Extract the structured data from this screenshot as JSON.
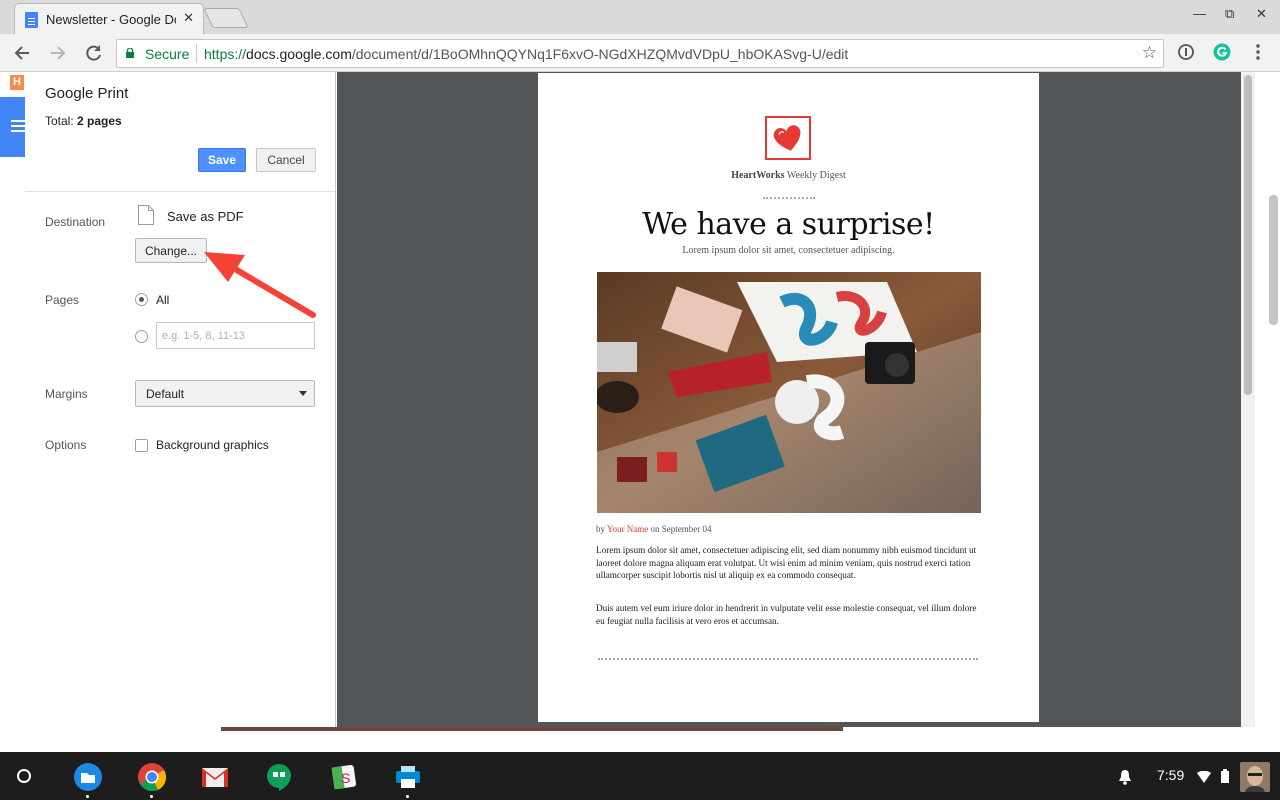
{
  "browser": {
    "tab_title": "Newsletter - Google Docs",
    "tab_close": "✕",
    "window_controls": {
      "minimize": "—",
      "maximize": "⧉",
      "close": "✕"
    },
    "address": {
      "secure_label": "Secure",
      "scheme": "https://",
      "host": "docs.google.com",
      "path": "/document/d/1BoOMhnQQYNq1F6xvO-NGdXHZQMvdVDpU_hbOKASvg-U/edit"
    },
    "icons": [
      "back-icon",
      "forward-icon",
      "reload-icon",
      "lock-icon",
      "star-icon",
      "info-extension-icon",
      "grammarly-icon",
      "menu-icon"
    ]
  },
  "docs": {
    "logo_letter": "H"
  },
  "print": {
    "title": "Google Print",
    "total_label": "Total:",
    "total_value": "2 pages",
    "save_label": "Save",
    "cancel_label": "Cancel",
    "destination_label": "Destination",
    "destination_value": "Save as PDF",
    "change_label": "Change...",
    "pages_label": "Pages",
    "pages_all": "All",
    "pages_placeholder": "e.g. 1-5, 8, 11-13",
    "margins_label": "Margins",
    "margins_value": "Default",
    "options_label": "Options",
    "background_graphics": "Background graphics",
    "arrow_color": "#f44336"
  },
  "newsletter": {
    "brand_bold": "HeartWorks",
    "brand_rest": " Weekly Digest",
    "headline": "We have a surprise!",
    "subheadline": "Lorem ipsum dolor sit amet, consectetuer adipiscing.",
    "byline_by": "by ",
    "byline_author": "Your Name",
    "byline_date": " on September 04",
    "paragraph1": "Lorem ipsum dolor sit amet, consectetuer adipiscing elit, sed diam nonummy nibh euismod tincidunt ut laoreet dolore magna aliquam erat volutpat. Ut wisi enim ad minim veniam, quis nostrud exerci tation ullamcorper suscipit lobortis nisl ut aliquip ex ea commodo consequat.",
    "paragraph2": "Duis autem vel eum iriure dolor in hendrerit in vulputate velit esse molestie consequat, vel illum dolore eu feugiat nulla facilisis at vero eros et accumsan.",
    "accent_color": "#e53935"
  },
  "shelf": {
    "time": "7:59",
    "apps": [
      "files-icon",
      "chrome-icon",
      "gmail-icon",
      "hangouts-icon",
      "slides-icon",
      "print-icon"
    ]
  }
}
